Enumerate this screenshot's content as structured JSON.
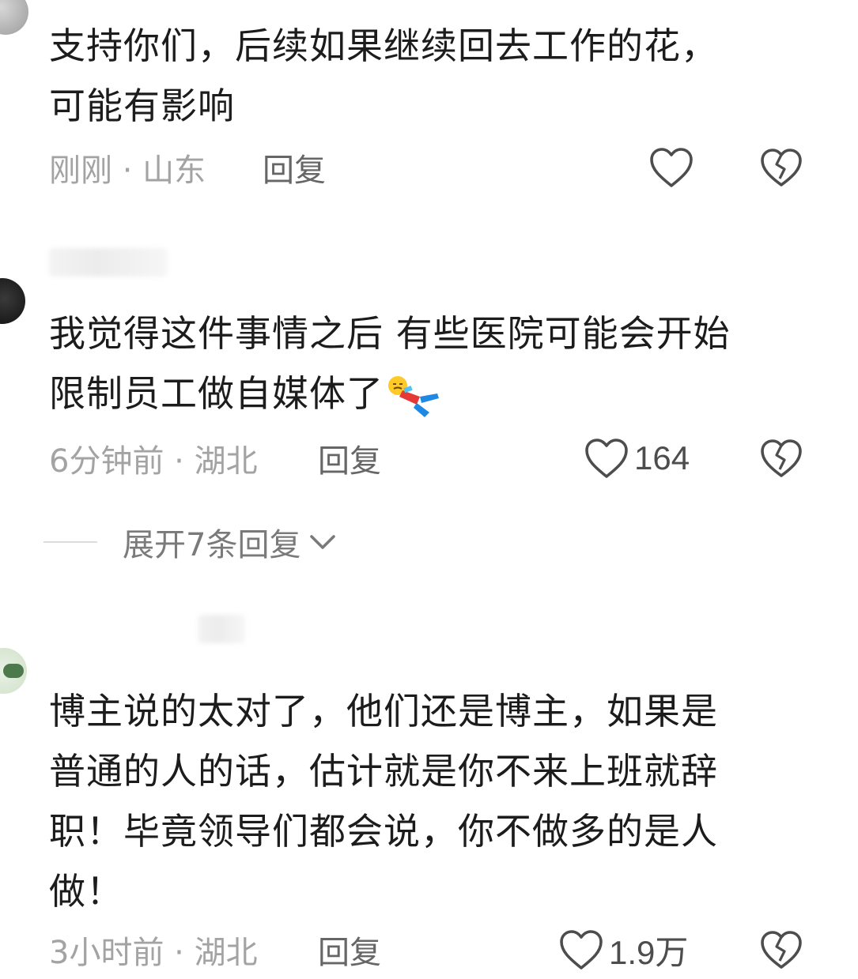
{
  "comments": [
    {
      "text": "支持你们，后续如果继续回去工作的花，\n可能有影响",
      "time": "刚刚",
      "location": "山东",
      "reply_label": "回复",
      "like_count": ""
    },
    {
      "text": "我觉得这件事情之后 有些医院可能会开始\n限制员工做自媒体了",
      "time": "6分钟前",
      "location": "湖北",
      "reply_label": "回复",
      "like_count": "164",
      "expand_label": "展开7条回复"
    },
    {
      "text": "博主说的太对了，他们还是博主，如果是\n普通的人的话，估计就是你不来上班就辞\n职！毕竟领导们都会说，你不做多的是人\n做！",
      "time": "3小时前",
      "location": "湖北",
      "reply_label": "回复",
      "like_count": "1.9万"
    }
  ],
  "meta_separator": " · ",
  "icons": {
    "like": "heart-outline-icon",
    "dislike": "broken-heart-icon",
    "expand": "chevron-down-icon",
    "emoji": "lying-flat-emoji"
  },
  "colors": {
    "text": "#1c1c1c",
    "meta": "#a3a3a3",
    "reply": "#666666",
    "icon": "#4d4d4d"
  }
}
